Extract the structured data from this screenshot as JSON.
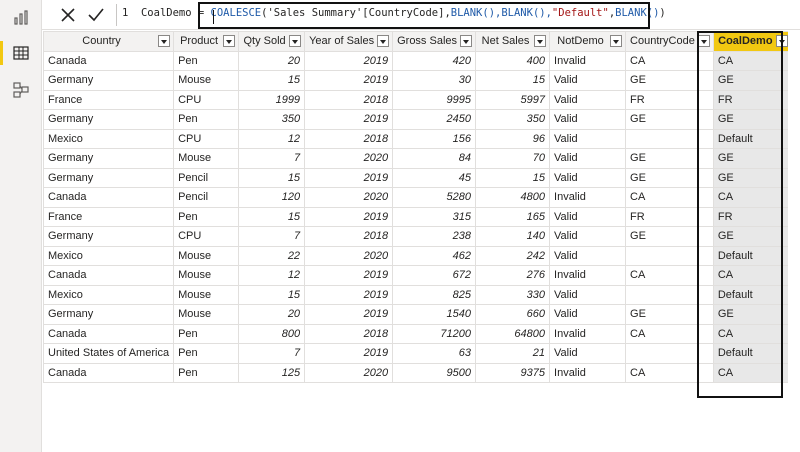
{
  "formula_bar": {
    "line_number": "1",
    "measure_name": "CoalDemo",
    "equals": " = ",
    "function_name": "COALESCE",
    "open_paren": "(",
    "arg1": "'Sales Summary'[CountryCode],",
    "blank1": "BLANK(),",
    "blank2": "BLANK(),",
    "default_str": "\"Default\"",
    "comma": ",",
    "blank3": "BLANK()",
    "close_paren": ")"
  },
  "columns": [
    "Country",
    "Product",
    "Qty Sold",
    "Year of Sales",
    "Gross Sales",
    "Net Sales",
    "NotDemo",
    "CountryCode",
    "CoalDemo"
  ],
  "rows": [
    [
      "Canada",
      "Pen",
      "20",
      "2019",
      "420",
      "400",
      "Invalid",
      "CA",
      "CA"
    ],
    [
      "Germany",
      "Mouse",
      "15",
      "2019",
      "30",
      "15",
      "Valid",
      "GE",
      "GE"
    ],
    [
      "France",
      "CPU",
      "1999",
      "2018",
      "9995",
      "5997",
      "Valid",
      "FR",
      "FR"
    ],
    [
      "Germany",
      "Pen",
      "350",
      "2019",
      "2450",
      "350",
      "Valid",
      "GE",
      "GE"
    ],
    [
      "Mexico",
      "CPU",
      "12",
      "2018",
      "156",
      "96",
      "Valid",
      "",
      "Default"
    ],
    [
      "Germany",
      "Mouse",
      "7",
      "2020",
      "84",
      "70",
      "Valid",
      "GE",
      "GE"
    ],
    [
      "Germany",
      "Pencil",
      "15",
      "2019",
      "45",
      "15",
      "Valid",
      "GE",
      "GE"
    ],
    [
      "Canada",
      "Pencil",
      "120",
      "2020",
      "5280",
      "4800",
      "Invalid",
      "CA",
      "CA"
    ],
    [
      "France",
      "Pen",
      "15",
      "2019",
      "315",
      "165",
      "Valid",
      "FR",
      "FR"
    ],
    [
      "Germany",
      "CPU",
      "7",
      "2018",
      "238",
      "140",
      "Valid",
      "GE",
      "GE"
    ],
    [
      "Mexico",
      "Mouse",
      "22",
      "2020",
      "462",
      "242",
      "Valid",
      "",
      "Default"
    ],
    [
      "Canada",
      "Mouse",
      "12",
      "2019",
      "672",
      "276",
      "Invalid",
      "CA",
      "CA"
    ],
    [
      "Mexico",
      "Mouse",
      "15",
      "2019",
      "825",
      "330",
      "Valid",
      "",
      "Default"
    ],
    [
      "Germany",
      "Mouse",
      "20",
      "2019",
      "1540",
      "660",
      "Valid",
      "GE",
      "GE"
    ],
    [
      "Canada",
      "Pen",
      "800",
      "2018",
      "71200",
      "64800",
      "Invalid",
      "CA",
      "CA"
    ],
    [
      "United States of America",
      "Pen",
      "7",
      "2019",
      "63",
      "21",
      "Valid",
      "",
      "Default"
    ],
    [
      "Canada",
      "Pen",
      "125",
      "2020",
      "9500",
      "9375",
      "Invalid",
      "CA",
      "CA"
    ]
  ],
  "colors": {
    "selected_header": "#f2c811",
    "header_bg": "#f3f2f1",
    "grid_line": "#e1dfdd",
    "function_blue": "#1f5aa8",
    "string_red": "#a31515"
  },
  "icons": [
    "report-view-icon",
    "data-view-icon",
    "model-view-icon",
    "cancel-x-icon",
    "commit-check-icon",
    "filter-dropdown-icon"
  ]
}
